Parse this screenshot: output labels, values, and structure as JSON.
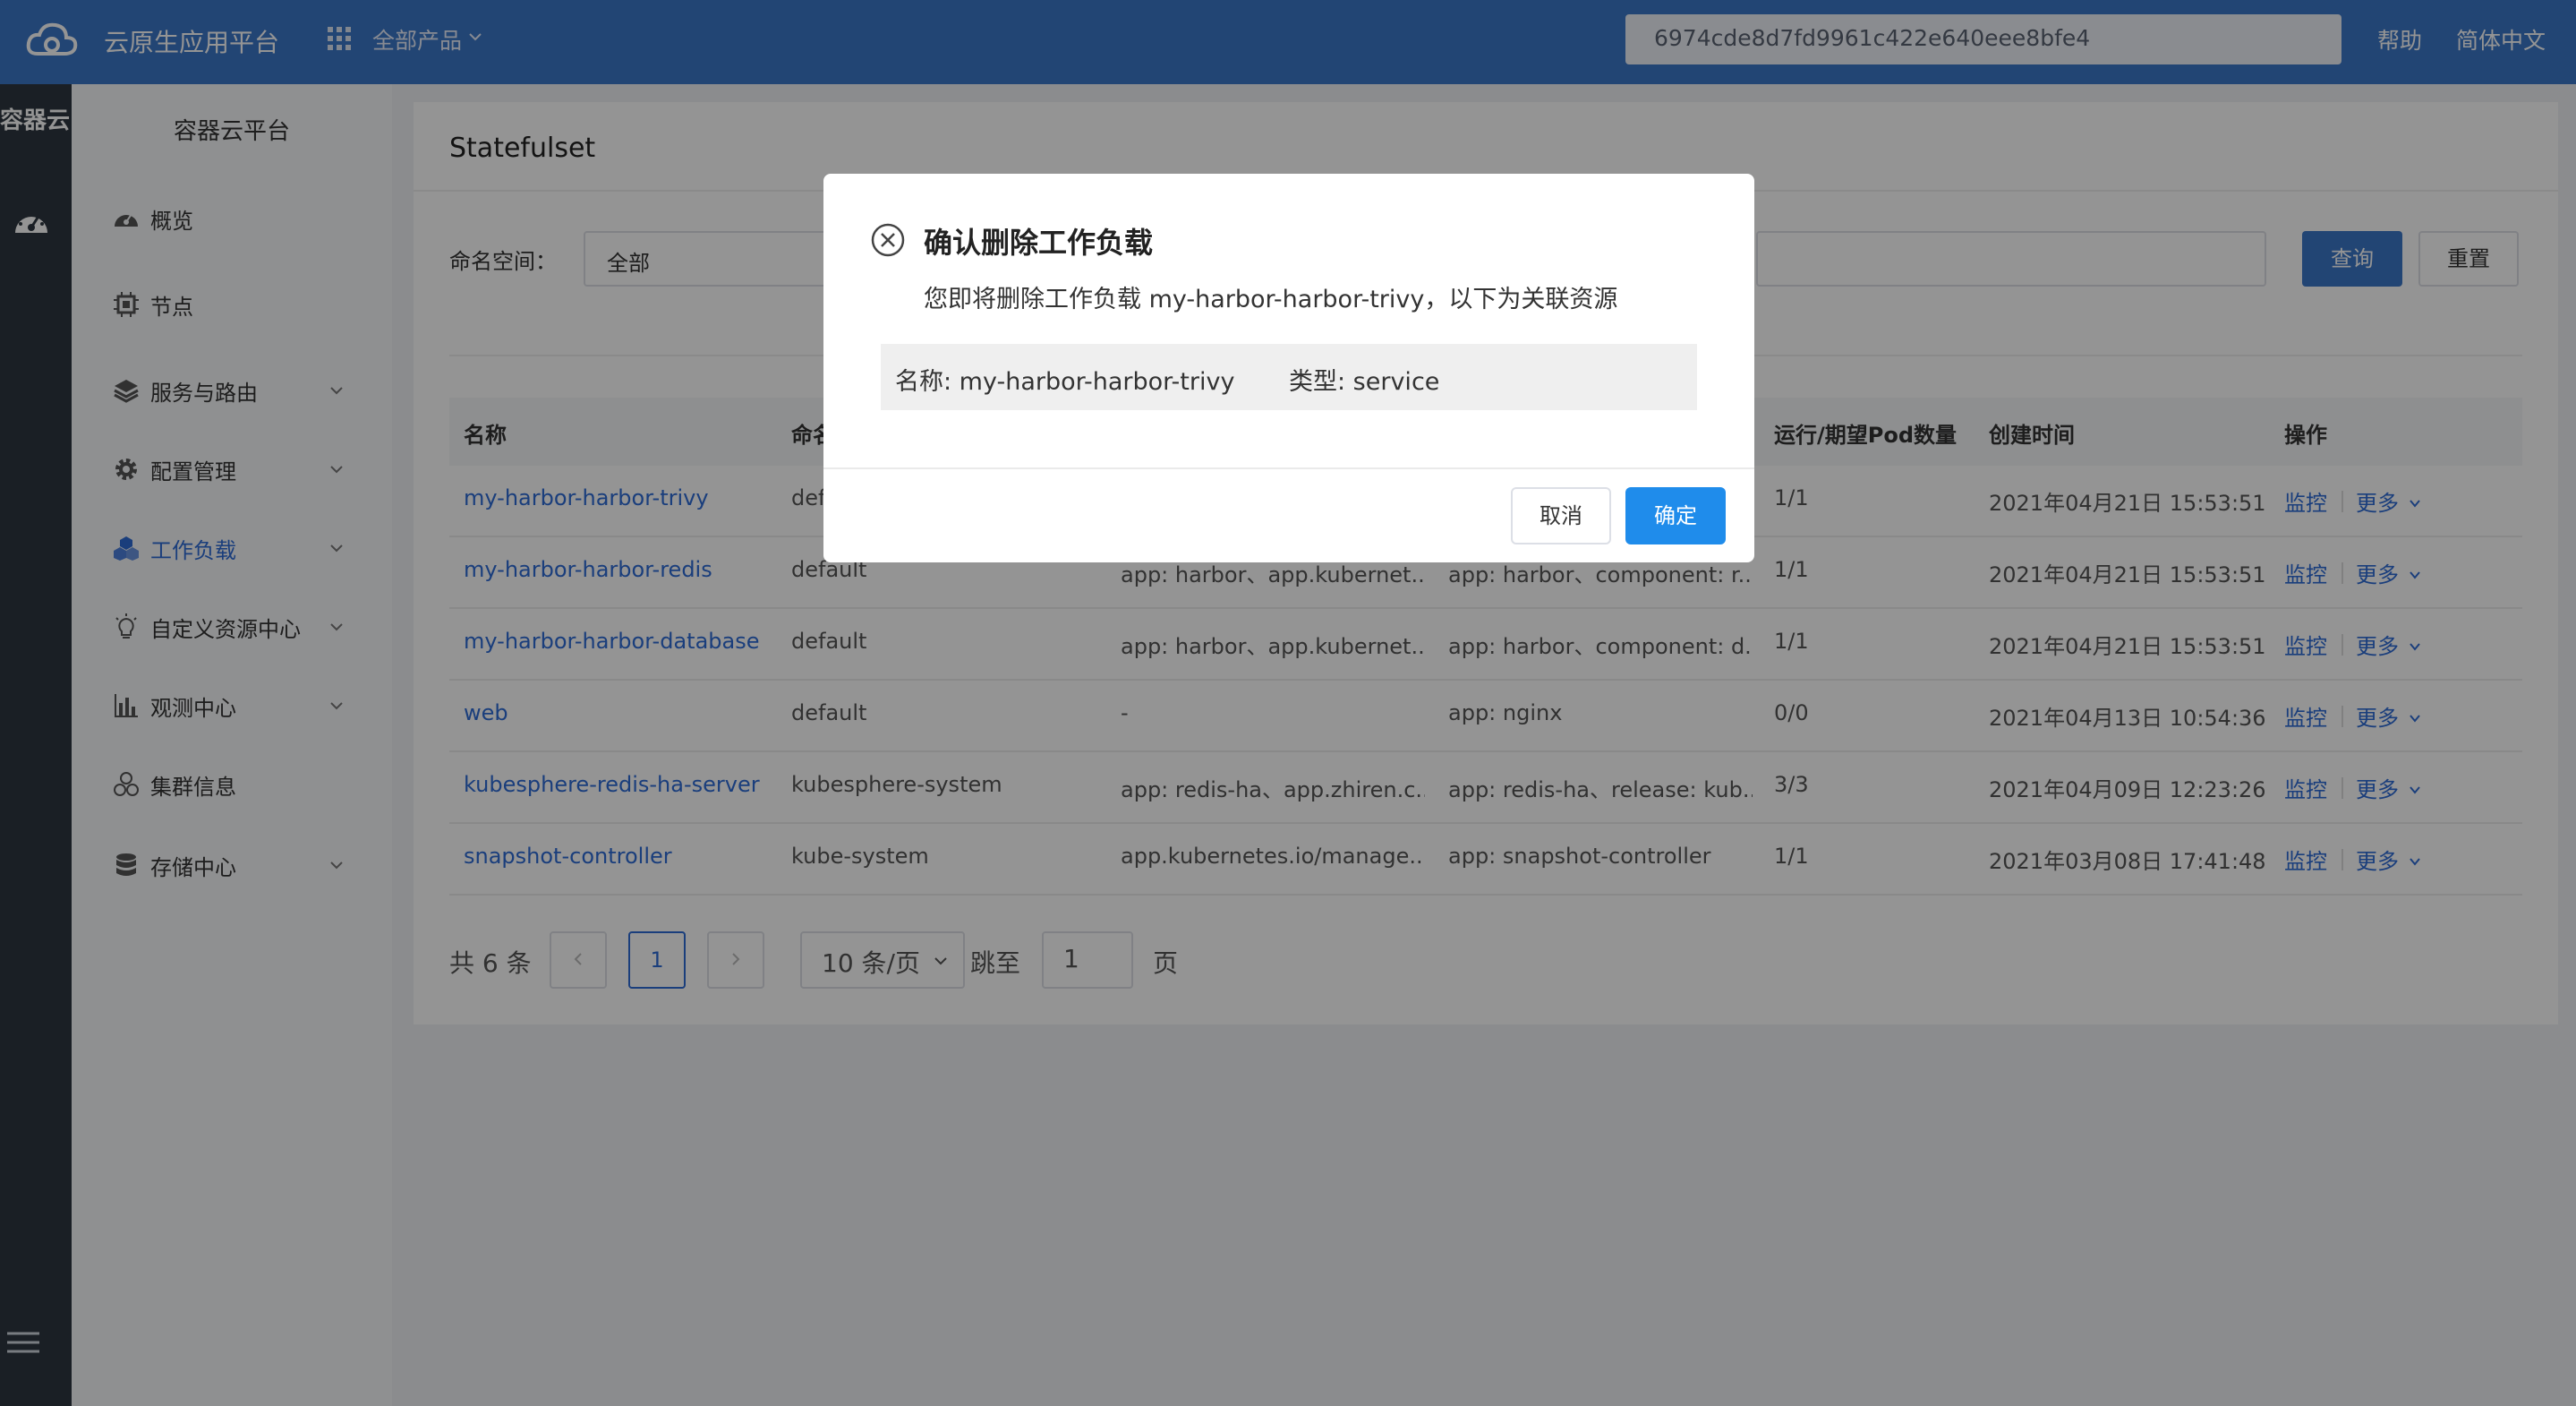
{
  "topbar": {
    "app_title": "云原生应用平台",
    "all_products": "全部产品",
    "token": "6974cde8d7fd9961c422e640eee8bfe4",
    "help": "帮助",
    "language": "简体中文"
  },
  "rail": {
    "title": "容器云"
  },
  "sidebar": {
    "title": "容器云平台",
    "items": [
      {
        "label": "概览",
        "icon": "dashboard-icon"
      },
      {
        "label": "节点",
        "icon": "chip-icon"
      },
      {
        "label": "服务与路由",
        "icon": "layers-icon"
      },
      {
        "label": "配置管理",
        "icon": "gear-icon"
      },
      {
        "label": "工作负载",
        "icon": "cubes-icon"
      },
      {
        "label": "自定义资源中心",
        "icon": "bulb-icon"
      },
      {
        "label": "观测中心",
        "icon": "bar-chart-icon"
      },
      {
        "label": "集群信息",
        "icon": "cluster-icon"
      },
      {
        "label": "存储中心",
        "icon": "database-icon"
      }
    ]
  },
  "page": {
    "title": "Statefulset",
    "namespace_label": "命名空间：",
    "namespace_value": "全部",
    "query_btn": "查询",
    "reset_btn": "重置"
  },
  "table": {
    "headers": {
      "name": "名称",
      "namespace": "命名",
      "pods": "运行/期望Pod数量",
      "created": "创建时间",
      "actions": "操作"
    },
    "rows": [
      {
        "name": "my-harbor-harbor-trivy",
        "namespace": "def",
        "labels": "",
        "selector": "",
        "pods": "1/1",
        "created": "2021年04月21日 15:53:51"
      },
      {
        "name": "my-harbor-harbor-redis",
        "namespace": "default",
        "labels": "app: harbor、app.kubernet...",
        "selector": "app: harbor、component: r...",
        "pods": "1/1",
        "created": "2021年04月21日 15:53:51"
      },
      {
        "name": "my-harbor-harbor-database",
        "namespace": "default",
        "labels": "app: harbor、app.kubernet...",
        "selector": "app: harbor、component: d...",
        "pods": "1/1",
        "created": "2021年04月21日 15:53:51"
      },
      {
        "name": "web",
        "namespace": "default",
        "labels": "-",
        "selector": "app: nginx",
        "pods": "0/0",
        "created": "2021年04月13日 10:54:36"
      },
      {
        "name": "kubesphere-redis-ha-server",
        "namespace": "kubesphere-system",
        "labels": "app: redis-ha、app.zhiren.c...",
        "selector": "app: redis-ha、release: kub...",
        "pods": "3/3",
        "created": "2021年04月09日 12:23:26"
      },
      {
        "name": "snapshot-controller",
        "namespace": "kube-system",
        "labels": "app.kubernetes.io/manage...",
        "selector": "app: snapshot-controller",
        "pods": "1/1",
        "created": "2021年03月08日 17:41:48"
      }
    ],
    "monitor_label": "监控",
    "more_label": "更多"
  },
  "pager": {
    "total": "共 6 条",
    "current_page": "1",
    "page_size": "10 条/页",
    "goto_label": "跳至",
    "goto_value": "1",
    "page_suffix": "页"
  },
  "modal": {
    "title": "确认删除工作负载",
    "description": "您即将删除工作负载 my-harbor-harbor-trivy，以下为关联资源",
    "resource_name": "名称: my-harbor-harbor-trivy",
    "resource_type": "类型: service",
    "cancel": "取消",
    "confirm": "确定"
  },
  "colors": {
    "topbar": "#3c77c9",
    "rail": "#2d3640",
    "link": "#2e6bd6",
    "confirm": "#1f8ceb"
  }
}
